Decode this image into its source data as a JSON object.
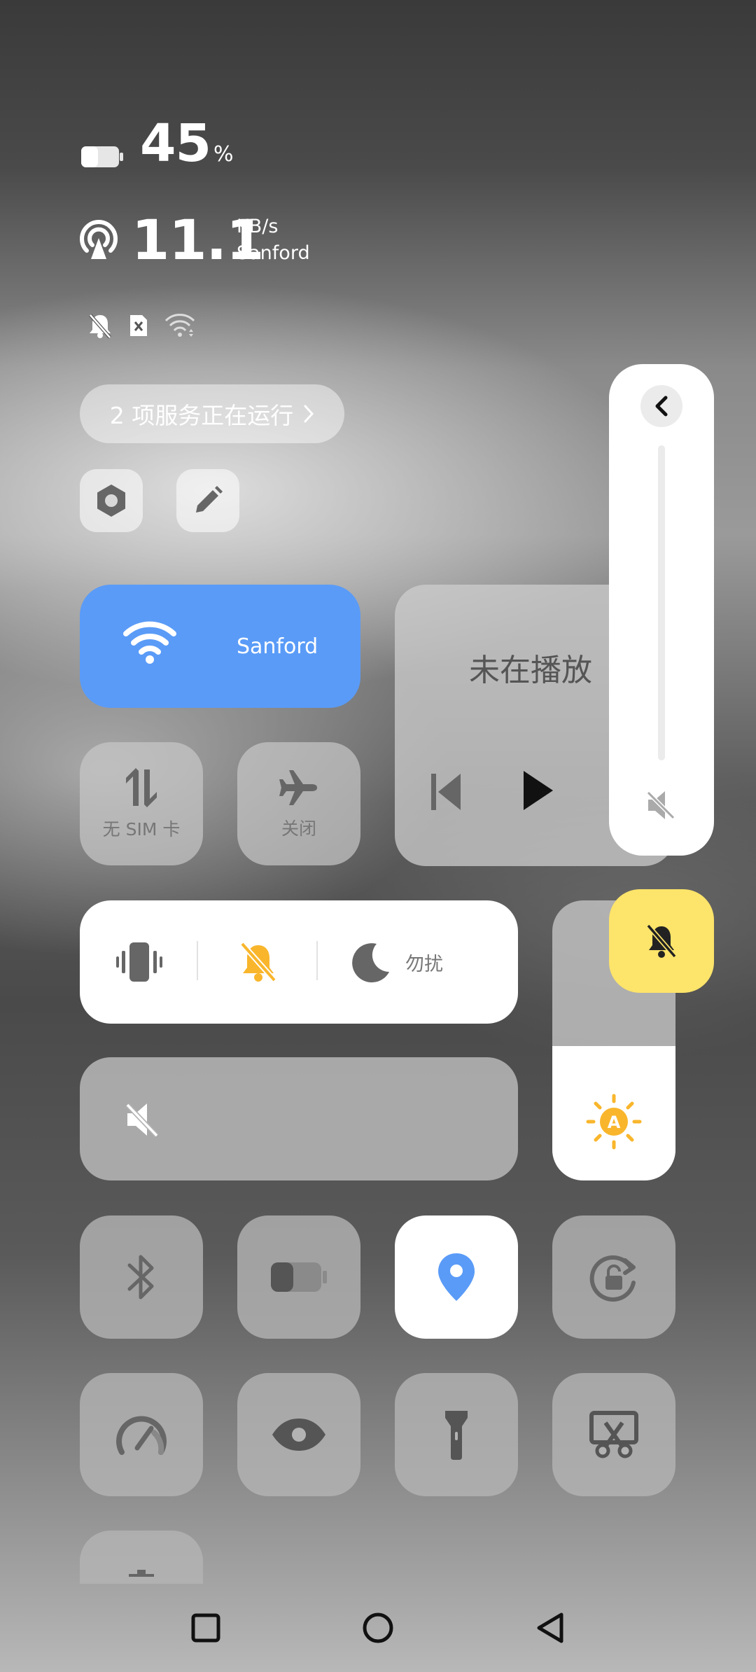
{
  "status": {
    "battery_percent": 45,
    "battery_value": "45",
    "battery_unit": "%",
    "net_speed": "11.1",
    "net_unit": "KB/s",
    "network_name": "Sanford"
  },
  "services": {
    "label": "2 项服务正在运行"
  },
  "tiles": {
    "wifi": {
      "label": "Sanford"
    },
    "mobile_data": {
      "label": "无 SIM 卡"
    },
    "airplane": {
      "label": "关闭"
    },
    "dnd": {
      "label": "勿扰"
    }
  },
  "media": {
    "status": "未在播放"
  },
  "volume": {
    "level": 0
  },
  "brightness": {
    "level": 0.48,
    "auto_label": "A"
  },
  "colors": {
    "accent_blue": "#5a9bf7",
    "ring_yellow": "#fde46a",
    "sun_orange": "#f9b62c"
  }
}
